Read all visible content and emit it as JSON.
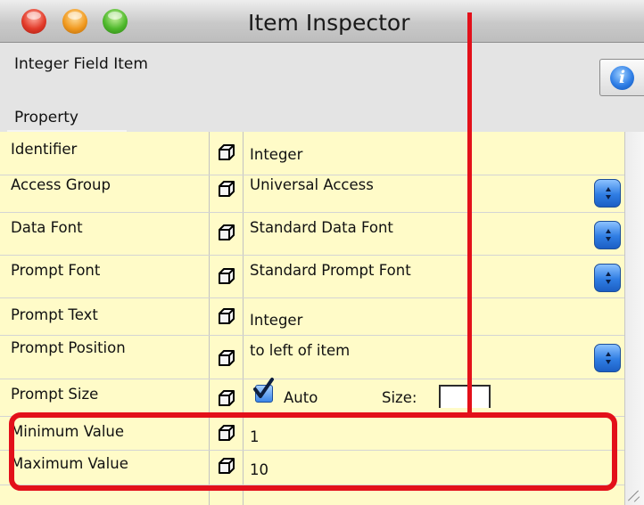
{
  "window": {
    "title": "Item Inspector"
  },
  "header": {
    "item_type": "Integer Field Item",
    "info_icon": "info-icon",
    "property_column": "Property"
  },
  "rows": [
    {
      "name": "Identifier",
      "value": "Integer",
      "has_stepper": false
    },
    {
      "name": "Access Group",
      "value": "Universal Access",
      "has_stepper": true
    },
    {
      "name": "Data Font",
      "value": "Standard Data Font",
      "has_stepper": true
    },
    {
      "name": "Prompt Font",
      "value": "Standard Prompt Font",
      "has_stepper": true
    },
    {
      "name": "Prompt Text",
      "value": "Integer",
      "has_stepper": false
    },
    {
      "name": "Prompt Position",
      "value": "to left of item",
      "has_stepper": true
    },
    {
      "name": "Prompt Size",
      "value": "",
      "has_stepper": false
    },
    {
      "name": "Minimum Value",
      "value": "1",
      "has_stepper": false
    },
    {
      "name": "Maximum Value",
      "value": "10",
      "has_stepper": false
    }
  ],
  "prompt_size": {
    "auto_label": "Auto",
    "auto_checked": true,
    "size_label": "Size:",
    "size_value": ""
  },
  "colors": {
    "table_background": "#fffbc8",
    "annotation_red": "#e3101a",
    "stepper_blue": "#2f7de3"
  },
  "icons": {
    "row_icon": "cube-icon",
    "stepper_icon": "popup-stepper-icon",
    "checkbox_icon": "checkmark-icon"
  }
}
